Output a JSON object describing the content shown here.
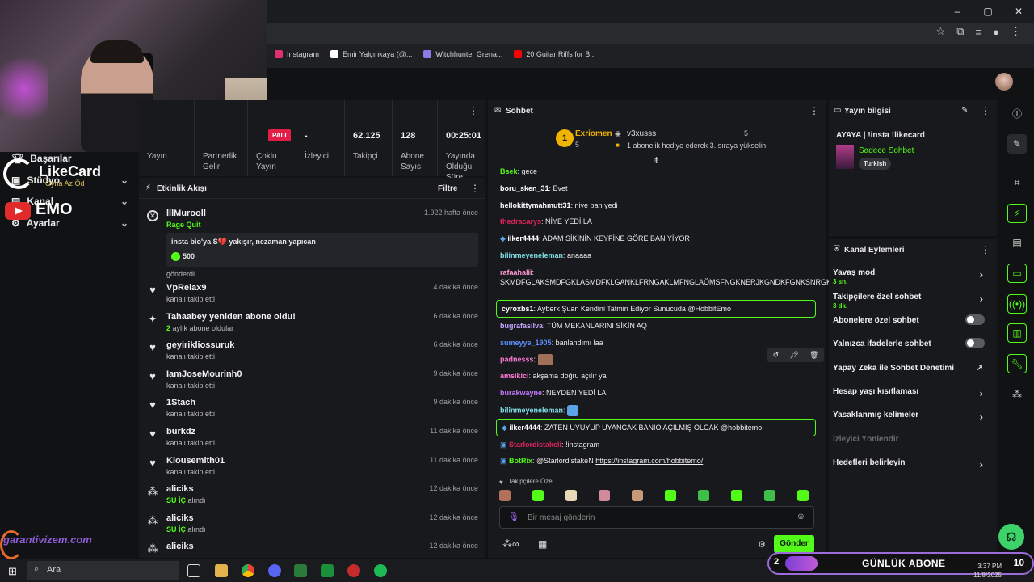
{
  "browser": {
    "bookmarks": [
      {
        "label": "Instagram",
        "color": "#e1306c"
      },
      {
        "label": "Emir Yalçınkaya (@...",
        "color": "#ffffff"
      },
      {
        "label": "Witchhunter Grena...",
        "color": "#8c7ae6"
      },
      {
        "label": "20 Guitar Riffs for B...",
        "color": "#ff0000"
      }
    ],
    "win_controls": [
      "–",
      "▢",
      "✕"
    ]
  },
  "overlay": {
    "likecard_title": "LikeCard",
    "likecard_sub": "Oyna  Az Öd",
    "emo": "EMO",
    "garanti": "garantivizem.com"
  },
  "sidebar": {
    "items": [
      {
        "label": "Başarılar",
        "icon": "trophy-icon"
      },
      {
        "label": "Stüdyo",
        "icon": "studio-icon"
      },
      {
        "label": "Kanal",
        "icon": "channel-icon"
      },
      {
        "label": "Ayarlar",
        "icon": "gear-icon"
      }
    ]
  },
  "stats": {
    "badge": "PALI",
    "cols": [
      {
        "value": "",
        "label": "Yayın"
      },
      {
        "value": "",
        "label": "Partnerlik Gelir"
      },
      {
        "value": "",
        "label": "Çoklu Yayın"
      },
      {
        "value": "-",
        "label": "İzleyici"
      },
      {
        "value": "62.125",
        "label": "Takipçi"
      },
      {
        "value": "128",
        "label": "Abone Sayısı"
      },
      {
        "value": "00:25:01",
        "label": "Yayında Olduğu Süre"
      }
    ]
  },
  "feed": {
    "title": "Etkinlik Akışı",
    "filter": "Filtre",
    "first": {
      "name": "lllMurooll",
      "action": "Rage Quit",
      "message": "insta bio'ya S💔 yakışır, nezaman yapıcan",
      "amount": "500",
      "sent": "gönderdi",
      "time": "1.922 hafta önce"
    },
    "items": [
      {
        "icon": "heart-icon",
        "name": "VpRelax9",
        "sub": "kanalı takip etti",
        "time": "4 dakika önce"
      },
      {
        "icon": "sparkle-icon",
        "name": "Tahaabey yeniden abone oldu!",
        "sub_green": "2",
        "sub": " aylık abone oldular",
        "time": "6 dakika önce"
      },
      {
        "icon": "heart-icon",
        "name": "geyirikliossuruk",
        "sub": "kanalı takip etti",
        "time": "6 dakika önce"
      },
      {
        "icon": "heart-icon",
        "name": "IamJoseMourinh0",
        "sub": "kanalı takip etti",
        "time": "9 dakika önce"
      },
      {
        "icon": "heart-icon",
        "name": "1Stach",
        "sub": "kanalı takip etti",
        "time": "9 dakika önce"
      },
      {
        "icon": "heart-icon",
        "name": "burkdz",
        "sub": "kanalı takip etti",
        "time": "11 dakika önce"
      },
      {
        "icon": "heart-icon",
        "name": "Klousemith01",
        "sub": "kanalı takip etti",
        "time": "11 dakika önce"
      },
      {
        "icon": "dots-icon",
        "name": "aliciks",
        "sub_green": "SU İÇ",
        "sub": " alındı",
        "time": "12 dakika önce"
      },
      {
        "icon": "dots-icon",
        "name": "aliciks",
        "sub_green": "SU İÇ",
        "sub": " alındı",
        "time": "12 dakika önce"
      },
      {
        "icon": "dots-icon",
        "name": "aliciks",
        "sub": "",
        "time": "12 dakika önce"
      }
    ]
  },
  "chat": {
    "title": "Sohbet",
    "leader": {
      "rank": "1",
      "name": "Exriomen",
      "count": "5",
      "second": "v3xusss",
      "second_count": "5",
      "gift_text": "1 abonelik hediye ederek 3. sıraya yükselin"
    },
    "messages": [
      {
        "user": "Bsek",
        "color": "#53fc18",
        "text": "gece"
      },
      {
        "user": "boru_sken_31",
        "color": "#ffffff",
        "text": "Evet"
      },
      {
        "user": "hellokittymahmutt31",
        "color": "#ffffff",
        "text": "niye ban yedi"
      },
      {
        "user": "thedracarys",
        "color": "#e0245e",
        "text": "NİYE YEDİ LA"
      },
      {
        "user": "ilker4444",
        "color": "#ffffff",
        "text": "ADAM SİKİNİN KEYFİNE GÖRE BAN YİYOR"
      },
      {
        "user": "bilinmeyeneleman",
        "color": "#7ee0e8",
        "text": "anaaaa"
      },
      {
        "user": "rafaahalii",
        "color": "#ff9ad5",
        "text": "SKMDFGLAKSMDFGKLASMDFKLGANKLFRNGAKLMFNGLAÖMSFNGKNERJKGNDKFGNKSNRGKDJR"
      },
      {
        "user": "cyroxbs1",
        "color": "#ffffff",
        "text": "Ayberk Şuan Kendini Tatmin Ediyor Sunucuda @HobbitEmo"
      },
      {
        "user": "bugrafasilva",
        "color": "#c7a6ff",
        "text": "TÜM MEKANLARINI SİKİN AQ"
      },
      {
        "user": "sumeyye_1905",
        "color": "#5a8dff",
        "text": "banlandımı laa"
      },
      {
        "user": "padnesss",
        "color": "#ff7ad9",
        "text": ""
      },
      {
        "user": "amsikici",
        "color": "#ff7ad9",
        "text": "akşama doğru açılır ya"
      },
      {
        "user": "burakwayne",
        "color": "#c678ff",
        "text": "NEYDEN YEDİ LA"
      },
      {
        "user": "bilinmeyeneleman",
        "color": "#7ee0e8",
        "text": ""
      },
      {
        "user": "ilker4444",
        "color": "#ffffff",
        "text": "ZATEN UYUYUP UYANCAK BANIO AÇILMIŞ OLCAK @hobbitemo"
      },
      {
        "user": "Starlordistakeli",
        "color": "#e0245e",
        "text": "!instagram"
      },
      {
        "user": "BotRix",
        "color": "#53fc18",
        "text": "@StarlordistakeN",
        "link": "https://instagram.com/hobbitemo/"
      }
    ],
    "followers_only": "Takipçilere Özel",
    "input_placeholder": "Bir mesaj gönderin",
    "send": "Gönder"
  },
  "info": {
    "title": "Yayın bilgisi",
    "stream_title": "AYAYA | !insta !likecard",
    "category": "Sadece Sohbet",
    "tag": "Turkish"
  },
  "actions": {
    "title": "Kanal Eylemleri",
    "rows": [
      {
        "label": "Yavaş mod",
        "sub": "3 sn.",
        "type": "chev"
      },
      {
        "label": "Takipçilere özel sohbet",
        "sub": "3 dk.",
        "type": "chev"
      },
      {
        "label": "Abonelere özel sohbet",
        "sub": "",
        "type": "toggle"
      },
      {
        "label": "Yalnızca ifadelerle sohbet",
        "sub": "",
        "type": "toggle"
      },
      {
        "label": "Yapay Zeka ile Sohbet Denetimi",
        "sub": "",
        "type": "ext"
      },
      {
        "label": "Hesap yaşı kısıtlaması",
        "sub": "",
        "type": "chev"
      },
      {
        "label": "Yasaklanmış kelimeler",
        "sub": "",
        "type": "chev"
      },
      {
        "label": "İzleyici Yönlendir",
        "sub": "",
        "type": "dim"
      },
      {
        "label": "Hedefleri belirleyin",
        "sub": "",
        "type": "chev"
      }
    ]
  },
  "taskbar": {
    "search": "Ara",
    "goal_num": "2",
    "goal_label": "GÜNLÜK ABONE",
    "goal_value": "10",
    "time": "3:37 PM",
    "date": "11/8/2025"
  },
  "colors": {
    "accent": "#53fc18",
    "panel": "#18191c"
  }
}
